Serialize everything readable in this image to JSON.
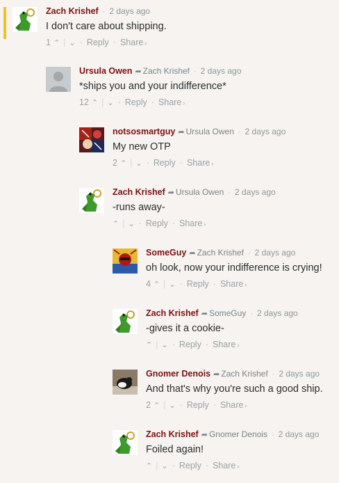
{
  "footer_labels": {
    "reply": "Reply",
    "share": "Share",
    "share_caret": "›",
    "bullet": "·"
  },
  "comments": [
    {
      "author": "Zach Krishef",
      "reply_to": "",
      "time": "2 days ago",
      "text": "I don't care about shipping.",
      "votes": "1",
      "avatar": "frog-avatar"
    },
    {
      "author": "Ursula Owen",
      "reply_to": "Zach Krishef",
      "time": "2 days ago",
      "text": "*ships you and your indifference*",
      "votes": "12",
      "avatar": "default-avatar"
    },
    {
      "author": "notsosmartguy",
      "reply_to": "Ursula Owen",
      "time": "2 days ago",
      "text": "My new OTP",
      "votes": "2",
      "avatar": "comic-avatar"
    },
    {
      "author": "Zach Krishef",
      "reply_to": "Ursula Owen",
      "time": "2 days ago",
      "text": "-runs away-",
      "votes": "",
      "avatar": "frog-avatar"
    },
    {
      "author": "SomeGuy",
      "reply_to": "Zach Krishef",
      "time": "2 days ago",
      "text": "oh look, now your indifference is crying!",
      "votes": "4",
      "avatar": "superhero-avatar"
    },
    {
      "author": "Zach Krishef",
      "reply_to": "SomeGuy",
      "time": "2 days ago",
      "text": "-gives it a cookie-",
      "votes": "",
      "avatar": "frog-avatar"
    },
    {
      "author": "Gnomer Denois",
      "reply_to": "Zach Krishef",
      "time": "2 days ago",
      "text": "And that's why you're such a good ship.",
      "votes": "2",
      "avatar": "cat-avatar"
    },
    {
      "author": "Zach Krishef",
      "reply_to": "Gnomer Denois",
      "time": "2 days ago",
      "text": "Foiled again!",
      "votes": "",
      "avatar": "frog-avatar"
    }
  ]
}
